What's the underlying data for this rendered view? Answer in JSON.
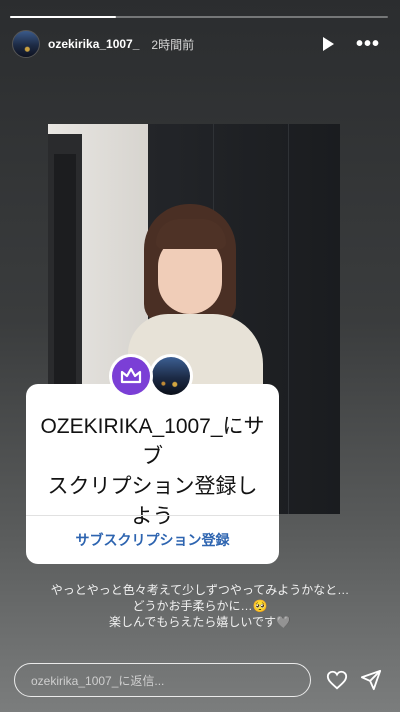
{
  "story": {
    "progress": 0.28,
    "username": "ozekirika_1007_",
    "time": "2時間前",
    "icons": {
      "play": "play-icon",
      "more": "more-icon",
      "avatar": "avatar"
    }
  },
  "subscription_card": {
    "title_lines": [
      "OZEKIRIKA_1007_にサブ",
      "スクリプション登録し",
      "よう"
    ],
    "action_label": "サブスクリプション登録",
    "badge_icon": "crown-icon",
    "badge_color": "#7b3fd6",
    "action_color": "#2d64b0"
  },
  "caption": {
    "lines": [
      "やっとやっと色々考えて少しずつやってみようかなと…",
      "どうかお手柔らかに…🥺",
      "楽しんでもらえたら嬉しいです🩶"
    ]
  },
  "reply": {
    "placeholder": "ozekirika_1007_に返信...",
    "icons": {
      "like": "heart-icon",
      "share": "send-icon"
    }
  }
}
